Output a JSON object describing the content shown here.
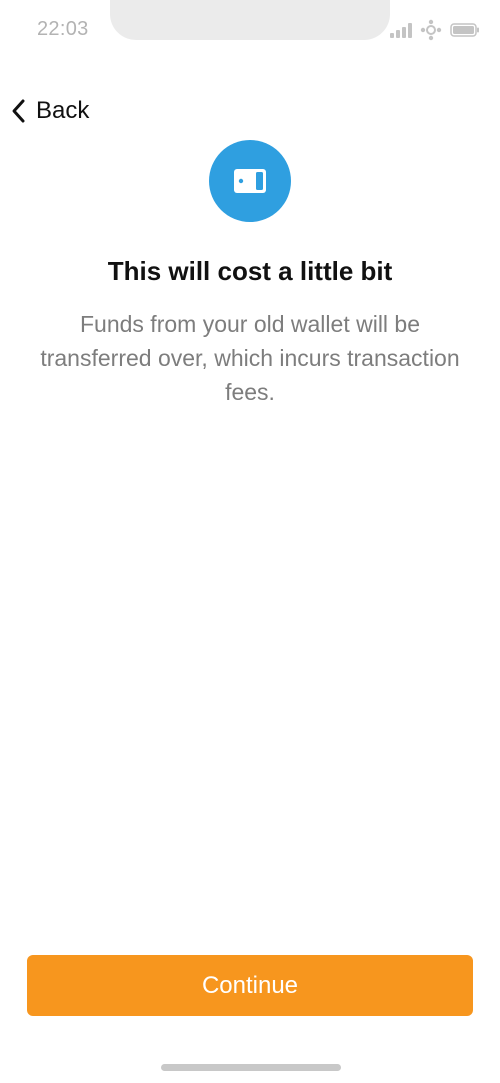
{
  "status_bar": {
    "time": "22:03",
    "icons": [
      "cellular-signal-icon",
      "network-icon",
      "battery-icon"
    ]
  },
  "nav": {
    "back_label": "Back",
    "back_icon": "chevron-left-icon"
  },
  "hero": {
    "icon": "wallet-icon",
    "icon_color": "#2f9fe0"
  },
  "content": {
    "title": "This will cost a little bit",
    "subtitle": "Funds from your old wallet will be transferred over, which incurs transaction fees."
  },
  "footer": {
    "continue_label": "Continue",
    "button_color": "#f7961e"
  }
}
